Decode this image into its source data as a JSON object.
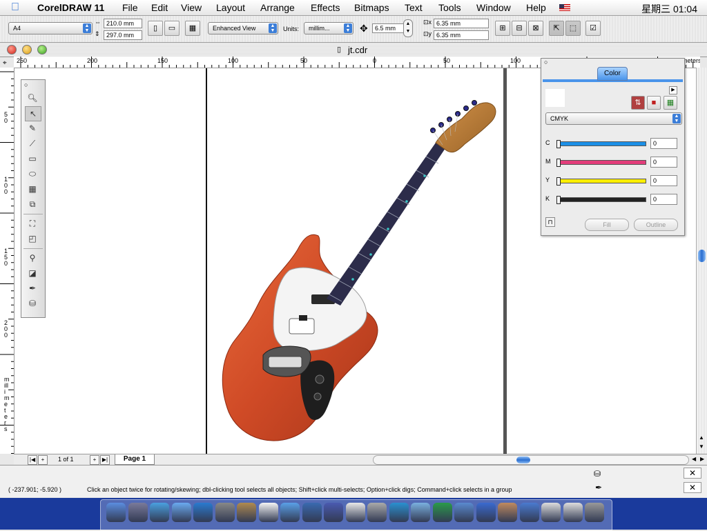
{
  "menubar": {
    "app_name": "CorelDRAW 11",
    "items": [
      "File",
      "Edit",
      "View",
      "Layout",
      "Arrange",
      "Effects",
      "Bitmaps",
      "Text",
      "Tools",
      "Window",
      "Help"
    ],
    "clock": "星期三 01:04"
  },
  "propbar": {
    "paper_size": "A4",
    "width": "210.0 mm",
    "height": "297.0 mm",
    "view_mode": "Enhanced View",
    "units_label": "Units:",
    "units_value": "millim...",
    "nudge": "6.5 mm",
    "dup_x": "6.35 mm",
    "dup_y": "6.35 mm"
  },
  "document": {
    "title": "jt.cdr",
    "ruler_h_ticks": [
      "250",
      "200",
      "150",
      "100",
      "50",
      "0",
      "50",
      "100"
    ],
    "ruler_v_ticks": [
      "50",
      "100",
      "150",
      "200"
    ],
    "ruler_v_units": "millimeters",
    "ruler_h_units": "meters",
    "page_counter": "1 of 1",
    "page_tab": "Page 1"
  },
  "status": {
    "coords": "( -237.901; -5.920 )",
    "hint": "Click an object twice for rotating/skewing; dbl-clicking tool selects all objects; Shift+click multi-selects; Option+click digs; Command+click selects in a group"
  },
  "toolbox": {
    "tools": [
      "zoom-tool",
      "pick-tool",
      "freehand-tool",
      "shape-tool",
      "rectangle-tool",
      "ellipse-tool",
      "graph-paper-tool",
      "basic-shapes-tool",
      "interactive-blend-tool",
      "interactive-transparency-tool",
      "eyedropper-tool",
      "interactive-fill-tool",
      "outline-tool",
      "fill-tool"
    ]
  },
  "color_docker": {
    "tab_label": "Color",
    "model": "CMYK",
    "channels": [
      {
        "label": "C",
        "value": "0",
        "color": "#1c8fe6"
      },
      {
        "label": "M",
        "value": "0",
        "color": "#e23d7a"
      },
      {
        "label": "Y",
        "value": "0",
        "color": "#ffee00"
      },
      {
        "label": "K",
        "value": "0",
        "color": "#222222"
      }
    ],
    "fill_label": "Fill",
    "outline_label": "Outline"
  },
  "dock": {
    "icons": [
      "finder-icon",
      "utility-icon",
      "ichat-icon",
      "network-icon",
      "ie-icon",
      "sherlock-icon",
      "addressbook-icon",
      "ical-icon",
      "itunes-icon",
      "iphoto-icon",
      "imovie-icon",
      "textedit-icon",
      "dvd-icon",
      "quicktime-icon",
      "preview-icon",
      "coreldraw-icon",
      "network-folder-icon",
      "mail-icon",
      "photo-icon",
      "app-icon",
      "sysprefs-icon",
      "docs-icon",
      "trash-icon"
    ]
  },
  "colors": {
    "guitar_body": "#cf4a26",
    "headstock": "#b77a36",
    "fretboard": "#2c2c4a",
    "desktop": "#1a3a9c"
  }
}
